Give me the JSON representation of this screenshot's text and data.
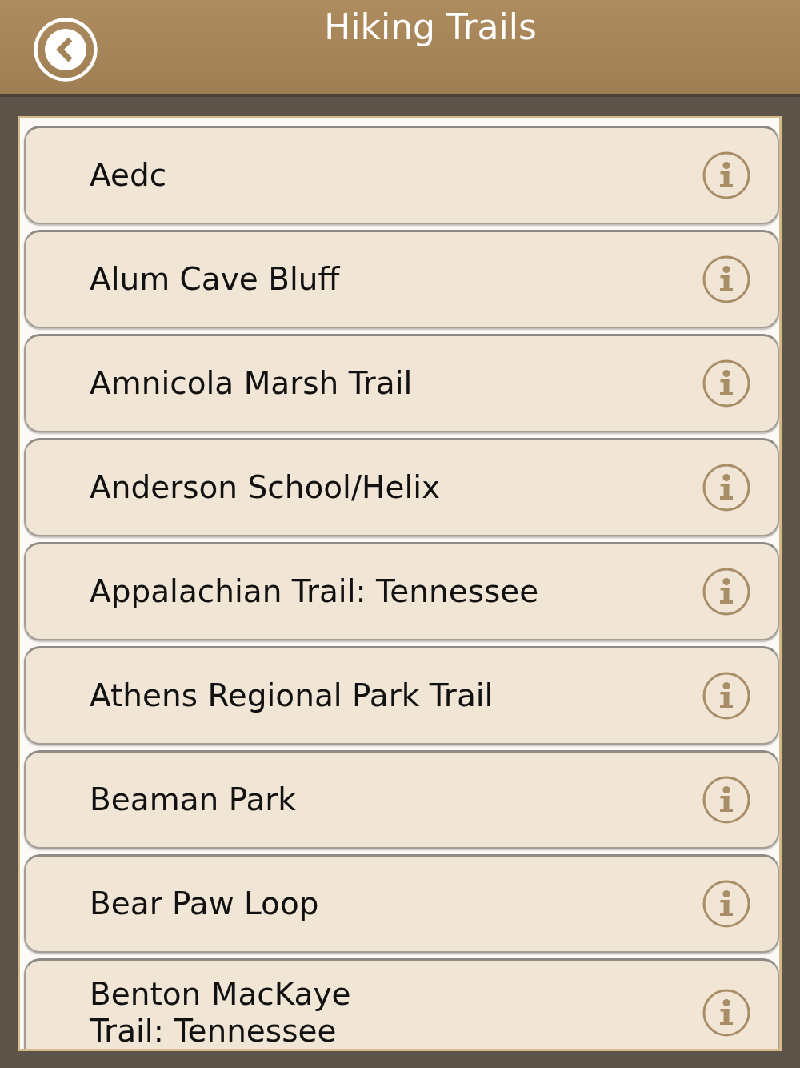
{
  "header": {
    "title": "Hiking Trails"
  },
  "trails": [
    {
      "name": "Aedc"
    },
    {
      "name": "Alum Cave Bluff"
    },
    {
      "name": "Amnicola Marsh Trail"
    },
    {
      "name": "Anderson School/Helix"
    },
    {
      "name": "Appalachian Trail: Tennessee"
    },
    {
      "name": "Athens Regional Park Trail"
    },
    {
      "name": "Beaman Park"
    },
    {
      "name": "Bear Paw Loop"
    },
    {
      "name": "Benton MacKaye\nTrail: Tennessee"
    }
  ]
}
